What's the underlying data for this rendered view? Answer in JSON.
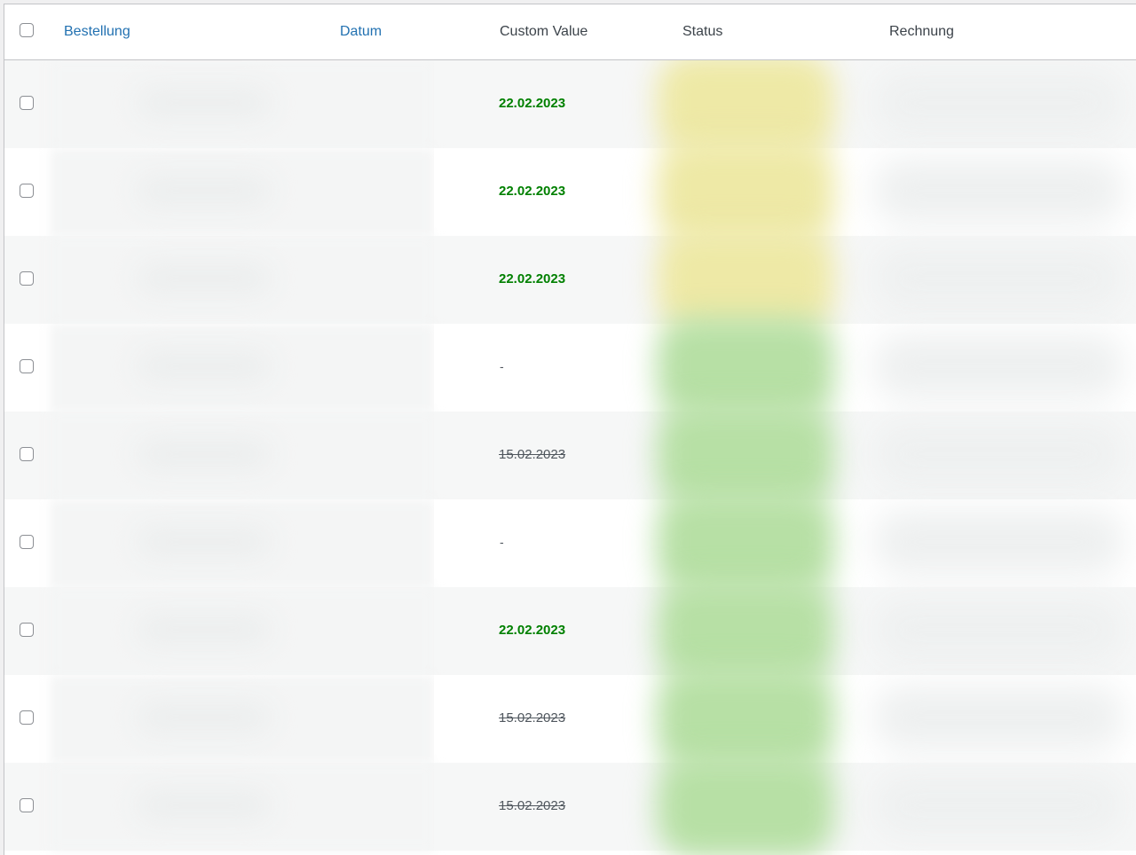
{
  "header": {
    "columns": {
      "order": "Bestellung",
      "date": "Datum",
      "custom": "Custom Value",
      "status": "Status",
      "invoice": "Rechnung"
    }
  },
  "rows": [
    {
      "custom_value": "22.02.2023",
      "style": "green",
      "status_color": "#eee9a6"
    },
    {
      "custom_value": "22.02.2023",
      "style": "green",
      "status_color": "#eee9a6"
    },
    {
      "custom_value": "22.02.2023",
      "style": "green",
      "status_color": "#eee9a6"
    },
    {
      "custom_value": "-",
      "style": "dash",
      "status_color": "#b7e0a5"
    },
    {
      "custom_value": "15.02.2023",
      "style": "strike",
      "status_color": "#b7e0a5"
    },
    {
      "custom_value": "-",
      "style": "dash",
      "status_color": "#b7e0a5"
    },
    {
      "custom_value": "22.02.2023",
      "style": "green",
      "status_color": "#b7e0a5"
    },
    {
      "custom_value": "15.02.2023",
      "style": "strike",
      "status_color": "#b7e0a5"
    },
    {
      "custom_value": "15.02.2023",
      "style": "strike",
      "status_color": "#b7e0a5"
    }
  ],
  "colors": {
    "link": "#2271b1",
    "highlight_green": "#008000",
    "status_yellow": "#eee9a6",
    "status_green": "#b7e0a5"
  }
}
